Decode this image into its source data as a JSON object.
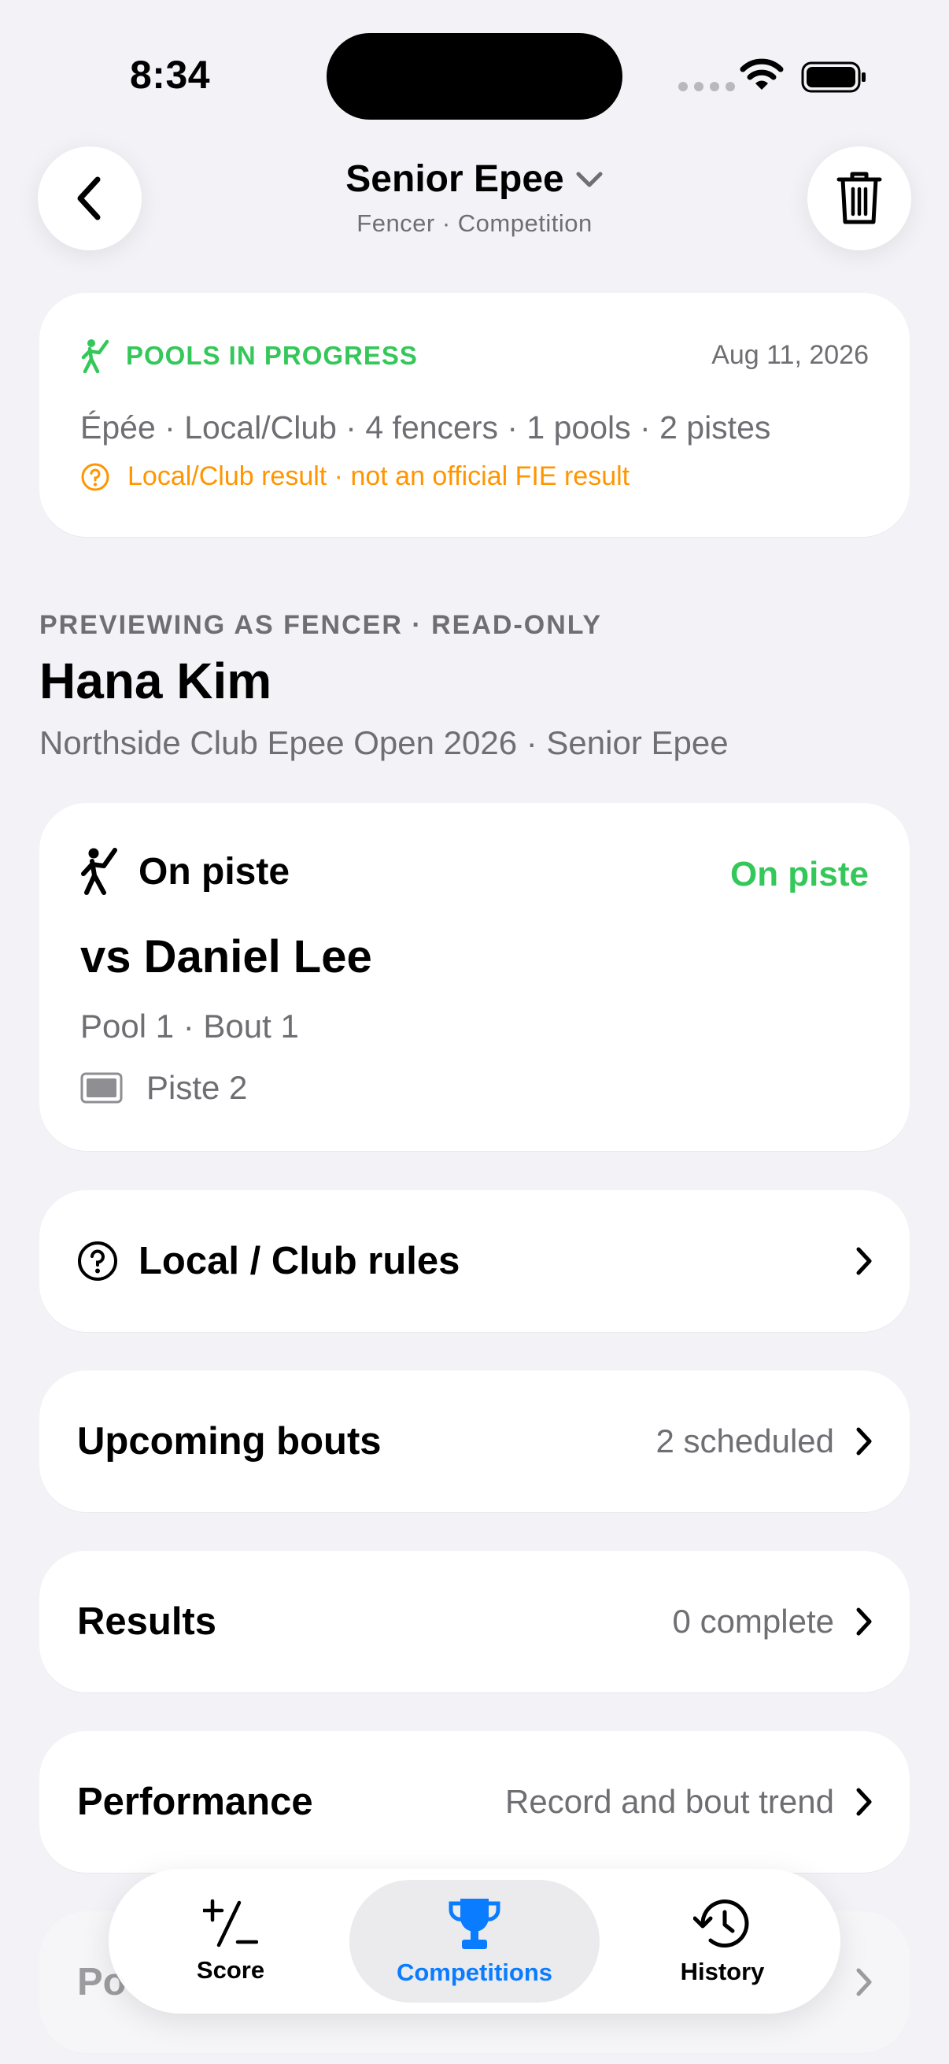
{
  "status_bar": {
    "time": "8:34"
  },
  "nav": {
    "title": "Senior Epee",
    "subtitle": "Fencer · Competition"
  },
  "status_card": {
    "status": "POOLS IN PROGRESS",
    "date": "Aug 11, 2026",
    "meta": "Épée · Local/Club · 4 fencers · 1 pools · 2 pistes",
    "warning": "Local/Club result · not an official FIE result",
    "status_color": "#34c759",
    "warning_color": "#ff9500"
  },
  "section": {
    "label": "PREVIEWING AS FENCER · READ-ONLY",
    "fencer_name": "Hana Kim",
    "competition": "Northside Club Epee Open 2026 · Senior Epee"
  },
  "bout_card": {
    "heading": "On piste",
    "badge": "On piste",
    "opponent": "vs Daniel Lee",
    "pool": "Pool 1 · Bout 1",
    "piste": "Piste 2"
  },
  "rows": {
    "rules": {
      "title": "Local / Club rules"
    },
    "upcoming": {
      "title": "Upcoming bouts",
      "value": "2 scheduled"
    },
    "results": {
      "title": "Results",
      "value": "0 complete"
    },
    "performance": {
      "title": "Performance",
      "value": "Record and bout trend"
    },
    "partial": {
      "title": "Po"
    }
  },
  "tabbar": {
    "score": "Score",
    "competitions": "Competitions",
    "history": "History",
    "active_color": "#0a7cff"
  }
}
